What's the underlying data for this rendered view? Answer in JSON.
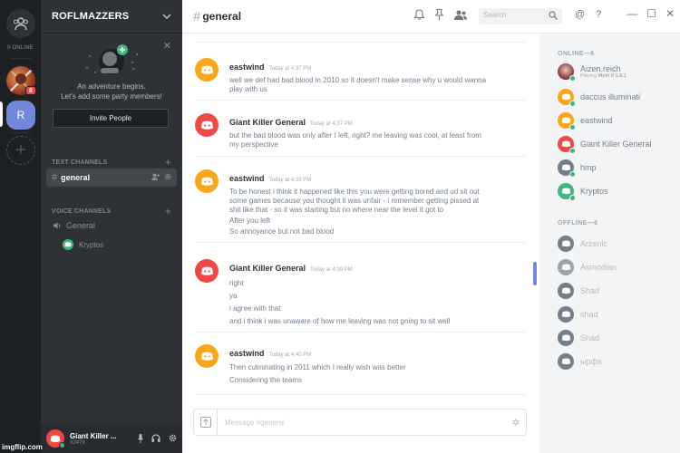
{
  "colors": {
    "orange": "#faa61a",
    "red": "#f04747",
    "grey": "#747f8d",
    "green": "#43b581",
    "blurple": "#7289da"
  },
  "rail": {
    "online_label": "0 ONLINE",
    "badge": "8",
    "server_initial": "R"
  },
  "server": {
    "name": "ROFLMAZZERS",
    "adventure_line1": "An adventure begins.",
    "adventure_line2": "Let's add some party members!",
    "invite_label": "Invite People"
  },
  "channels": {
    "text_header": "TEXT CHANNELS",
    "active_channel": "general",
    "voice_header": "VOICE CHANNELS",
    "voice_channel": "General",
    "voice_user": "Kryptos"
  },
  "user": {
    "name": "Giant Killer ...",
    "discriminator": "#2479"
  },
  "header": {
    "hash": "#",
    "channel": "general",
    "search_placeholder": "Search"
  },
  "messages": [
    {
      "author": "eastwind",
      "avatar": "orange",
      "timestamp": "Today at 4:37 PM",
      "lines": [
        "well we def had bad blood in 2010 so it doesn't make sense why u would wanna play with us"
      ]
    },
    {
      "author": "Giant Killer General",
      "avatar": "red",
      "timestamp": "Today at 4:37 PM",
      "lines": [
        "but the bad blood was only after I left, right? me leaving was cool, at least from my perspective"
      ]
    },
    {
      "author": "eastwind",
      "avatar": "orange",
      "timestamp": "Today at 4:39 PM",
      "lines": [
        "To be honest i think it happened like this you were getting bored and ud sit out some games because you thought it was unfair - i remember getting pissed at shit like that - so it was starting but no where near the level it got to",
        "After you left",
        "So annoyance but not bad blood"
      ]
    },
    {
      "author": "Giant Killer General",
      "avatar": "red",
      "timestamp": "Today at 4:39 PM",
      "lines": [
        "right",
        "ya",
        "i agree with that",
        "and i think i was unaware of how me leaving was not going to sit well"
      ]
    },
    {
      "author": "eastwind",
      "avatar": "orange",
      "timestamp": "Today at 4:40 PM",
      "lines": [
        "Then culminating in 2011 which I really wish was better",
        "Considering the teams"
      ]
    }
  ],
  "composer": {
    "placeholder": "Message #general"
  },
  "members": {
    "online_header": "ONLINE—6",
    "offline_header": "OFFLINE—6",
    "online": [
      {
        "name": "Aizen.reich",
        "game_prefix": "Playing ",
        "game": "Myth II 1.8.1",
        "avatar": "photo"
      },
      {
        "name": "daccus illuminati",
        "avatar": "orange"
      },
      {
        "name": "eastwind",
        "avatar": "orange"
      },
      {
        "name": "Giant Killer General",
        "avatar": "red"
      },
      {
        "name": "hmp",
        "avatar": "grey"
      },
      {
        "name": "Kryptos",
        "avatar": "green"
      }
    ],
    "offline": [
      {
        "name": "Arzenic"
      },
      {
        "name": "Asmodian"
      },
      {
        "name": "Shad"
      },
      {
        "name": "shad"
      },
      {
        "name": "Shad"
      },
      {
        "name": "ырфв"
      }
    ]
  },
  "watermark": "imgflip.com"
}
